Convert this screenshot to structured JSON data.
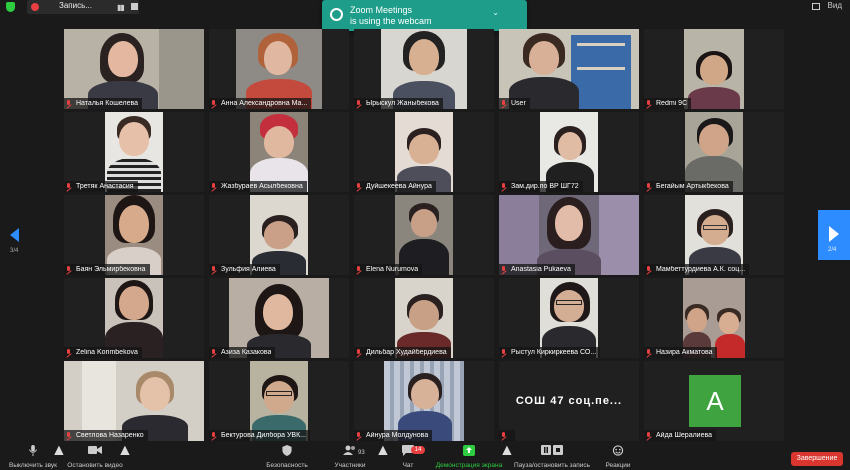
{
  "topbar": {
    "recording_label": "Запись...",
    "view_label": "Вид"
  },
  "notification": {
    "title": "Zoom Meetings",
    "text": "is using the webcam"
  },
  "tiles": [
    {
      "name": "Наталья Кошелева"
    },
    {
      "name": "Анна Александровна Ма..."
    },
    {
      "name": "Ырыскул Жаныбекова"
    },
    {
      "name": "User"
    },
    {
      "name": "Redmi 9C"
    },
    {
      "name": "Третяк Анастасия"
    },
    {
      "name": "Жазбураев Асылбековна"
    },
    {
      "name": "Дуйшекеева Айнура"
    },
    {
      "name": "Зам.дир.по ВР ШГ72"
    },
    {
      "name": "Бегайым Артыкбекова"
    },
    {
      "name": "Баян Эльмирбековна"
    },
    {
      "name": "Зульфия Алиева"
    },
    {
      "name": "Elena Nurumova"
    },
    {
      "name": "Anastasia Pukaeva"
    },
    {
      "name": "Мамбеттурдиева А.К. соц..."
    },
    {
      "name": "Zelina Korimbekova"
    },
    {
      "name": "Азиза Казакова"
    },
    {
      "name": "Дильбар Худайбердиева"
    },
    {
      "name": "Рыстул Киркиркеева СО..."
    },
    {
      "name": "Назира Акматова"
    },
    {
      "name": "Светлова Назаренко"
    },
    {
      "name": "Бектурова Дилбора УВК..."
    },
    {
      "name": "Айнура Молдунова"
    },
    {
      "name": "",
      "display_text": "СОШ 47 соц.пе..."
    },
    {
      "name": "Айда Шералиева",
      "avatar_letter": "A",
      "avatar_color": "#3fa43f"
    }
  ],
  "paging": {
    "left_page": "3/4",
    "right_page": "2/4"
  },
  "toolbar": {
    "mute": "Выключить звук",
    "video": "Остановить видео",
    "security": "Безопасность",
    "participants": "Участники",
    "participants_count": "93",
    "chat": "Чат",
    "chat_badge": "14",
    "share": "Демонстрация экрана",
    "record": "Пауза/остановить запись",
    "reactions": "Реакции",
    "end": "Завершение"
  },
  "colors": {
    "accent": "#2d8cff",
    "share_green": "#2ecc40",
    "end_red": "#d9362f",
    "notification": "#1e9e8a"
  }
}
